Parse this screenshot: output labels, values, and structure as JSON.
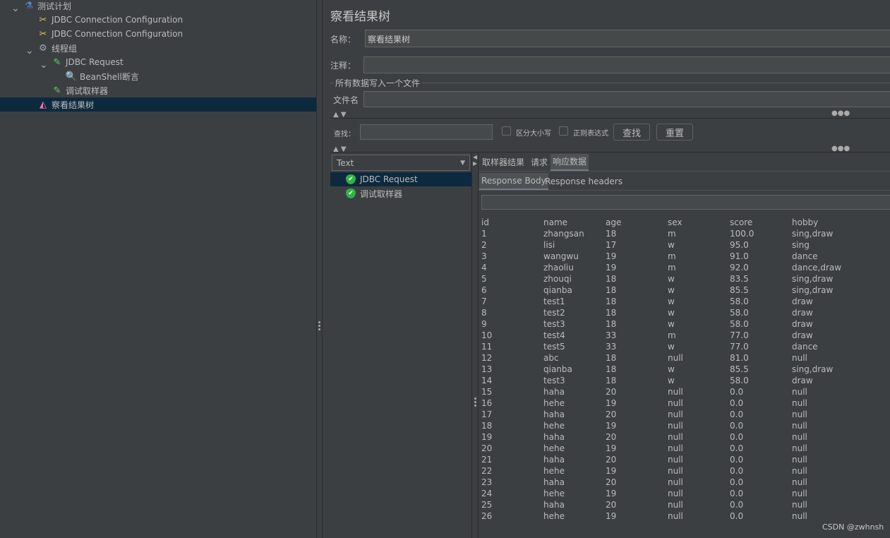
{
  "tree": {
    "items": [
      {
        "label": "测试计划",
        "icon": "flask-icon"
      },
      {
        "label": "JDBC Connection Configuration",
        "icon": "wrench-icon"
      },
      {
        "label": "JDBC Connection Configuration",
        "icon": "wrench-icon"
      },
      {
        "label": "线程组",
        "icon": "gear-icon"
      },
      {
        "label": "JDBC Request",
        "icon": "pipette-icon"
      },
      {
        "label": "BeanShell断言",
        "icon": "magnifier-icon"
      },
      {
        "label": "调试取样器",
        "icon": "pipette-icon"
      },
      {
        "label": "察看结果树",
        "icon": "chart-icon",
        "selected": true
      }
    ]
  },
  "panel": {
    "title": "察看结果树",
    "name_label": "名称：",
    "name_value": "察看结果树",
    "comment_label": "注释：",
    "comment_value": "",
    "file_group": "所有数据写入一个文件",
    "filename_label": "文件名",
    "filename_value": ""
  },
  "search": {
    "label": "查找：",
    "value": "",
    "case_label": "区分大小写",
    "regex_label": "正则表达式",
    "find_button": "查找",
    "reset_button": "重置"
  },
  "results": {
    "renderer": "Text",
    "samples": [
      {
        "label": "JDBC Request",
        "status": "success",
        "selected": true
      },
      {
        "label": "调试取样器",
        "status": "success"
      }
    ],
    "tabs": [
      "取样器结果",
      "请求",
      "响应数据"
    ],
    "active_tab": "响应数据",
    "subtabs": [
      "Response Body",
      "Response headers"
    ],
    "active_subtab": "Response Body",
    "body_search": "",
    "columns": [
      "id",
      "name",
      "age",
      "sex",
      "score",
      "hobby"
    ],
    "rows": [
      [
        "1",
        "zhangsan",
        "18",
        "m",
        "100.0",
        "sing,draw"
      ],
      [
        "2",
        "lisi",
        "17",
        "w",
        "95.0",
        "sing"
      ],
      [
        "3",
        "wangwu",
        "19",
        "m",
        "91.0",
        "dance"
      ],
      [
        "4",
        "zhaoliu",
        "19",
        "m",
        "92.0",
        "dance,draw"
      ],
      [
        "5",
        "zhouqi",
        "18",
        "w",
        "83.5",
        "sing,draw"
      ],
      [
        "6",
        "qianba",
        "18",
        "w",
        "85.5",
        "sing,draw"
      ],
      [
        "7",
        "test1",
        "18",
        "w",
        "58.0",
        "draw"
      ],
      [
        "8",
        "test2",
        "18",
        "w",
        "58.0",
        "draw"
      ],
      [
        "9",
        "test3",
        "18",
        "w",
        "58.0",
        "draw"
      ],
      [
        "10",
        "test4",
        "33",
        "m",
        "77.0",
        "draw"
      ],
      [
        "11",
        "test5",
        "33",
        "w",
        "77.0",
        "dance"
      ],
      [
        "12",
        "abc",
        "18",
        "null",
        "81.0",
        "null"
      ],
      [
        "13",
        "qianba",
        "18",
        "w",
        "85.5",
        "sing,draw"
      ],
      [
        "14",
        "test3",
        "18",
        "w",
        "58.0",
        "draw"
      ],
      [
        "15",
        "haha",
        "20",
        "null",
        "0.0",
        "null"
      ],
      [
        "16",
        "hehe",
        "19",
        "null",
        "0.0",
        "null"
      ],
      [
        "17",
        "haha",
        "20",
        "null",
        "0.0",
        "null"
      ],
      [
        "18",
        "hehe",
        "19",
        "null",
        "0.0",
        "null"
      ],
      [
        "19",
        "haha",
        "20",
        "null",
        "0.0",
        "null"
      ],
      [
        "20",
        "hehe",
        "19",
        "null",
        "0.0",
        "null"
      ],
      [
        "21",
        "haha",
        "20",
        "null",
        "0.0",
        "null"
      ],
      [
        "22",
        "hehe",
        "19",
        "null",
        "0.0",
        "null"
      ],
      [
        "23",
        "haha",
        "20",
        "null",
        "0.0",
        "null"
      ],
      [
        "24",
        "hehe",
        "19",
        "null",
        "0.0",
        "null"
      ],
      [
        "25",
        "haha",
        "20",
        "null",
        "0.0",
        "null"
      ],
      [
        "26",
        "hehe",
        "19",
        "null",
        "0.0",
        "null"
      ]
    ]
  },
  "watermark": "CSDN @zwhnsh",
  "colors": {
    "background": "#3c3f41",
    "selection": "#0d293e",
    "input": "#45494a",
    "success": "#2fb344"
  }
}
